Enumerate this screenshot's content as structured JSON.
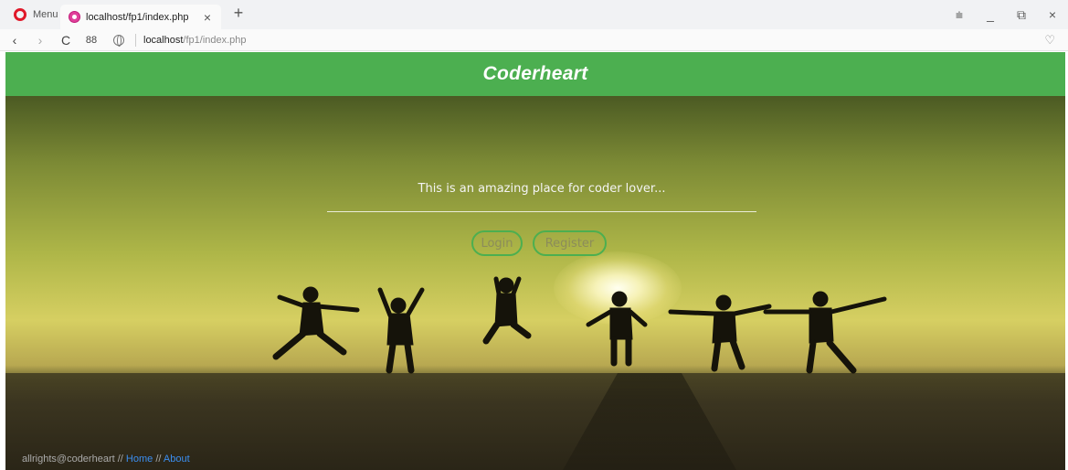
{
  "browser": {
    "menu_label": "Menu",
    "tab_title": "localhost/fp1/index.php",
    "tab_close": "×",
    "new_tab": "+",
    "url_host": "localhost",
    "url_path": "/fp1/index.php",
    "back": "‹",
    "forward": "›",
    "reload": "C",
    "speed_dial": "88",
    "win_minimize": "_",
    "win_restore": "⧉",
    "win_close": "×",
    "easy_setup": "⩧",
    "heart": "♡"
  },
  "header": {
    "title": "Coderheart"
  },
  "hero": {
    "tagline": "This is an amazing place for coder lover...",
    "login_label": "Login",
    "register_label": "Register"
  },
  "footer": {
    "copyright": "allrights@coderheart",
    "separator": "//",
    "home_label": "Home",
    "about_label": "About"
  },
  "colors": {
    "brand_green": "#4caf50",
    "link_blue": "#3b8ef0"
  }
}
